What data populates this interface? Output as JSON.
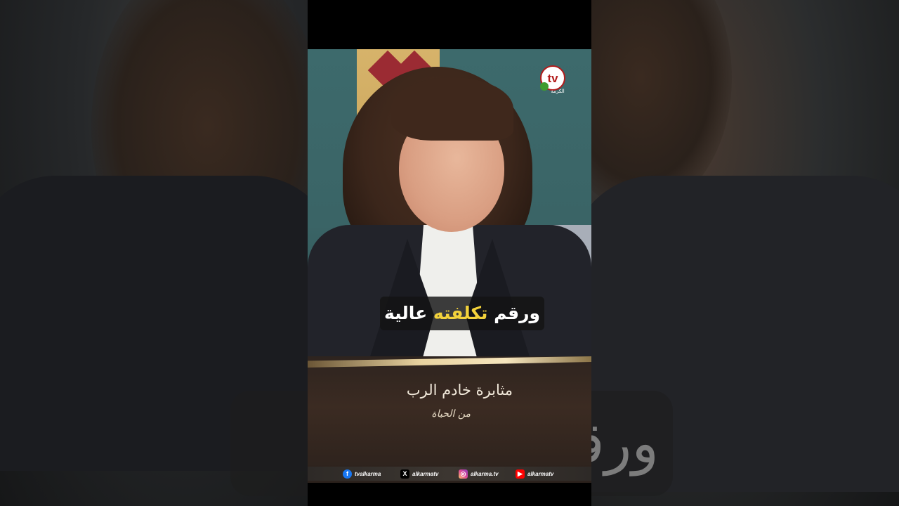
{
  "caption": {
    "before": "ورقم ",
    "highlight": "تكلفته",
    "after": " عالية",
    "highlight_color": "#f3d23b",
    "background_blur_text": "ورقم عالية"
  },
  "show": {
    "title": "مثابرة خادم الرب",
    "subtitle": "من الحياة"
  },
  "logo": {
    "letters": "tv",
    "name": "الكرمة"
  },
  "social": [
    {
      "icon": "facebook-icon",
      "glyph": "f",
      "color": "#1877f2",
      "handle": "tvalkarma"
    },
    {
      "icon": "x-icon",
      "glyph": "X",
      "color": "#000000",
      "handle": "alkarmatv"
    },
    {
      "icon": "instagram-icon",
      "glyph": "◎",
      "color": "#d6249f",
      "handle": "alkarma.tv"
    },
    {
      "icon": "youtube-icon",
      "glyph": "▶",
      "color": "#ff0000",
      "handle": "alkarmatv"
    }
  ]
}
